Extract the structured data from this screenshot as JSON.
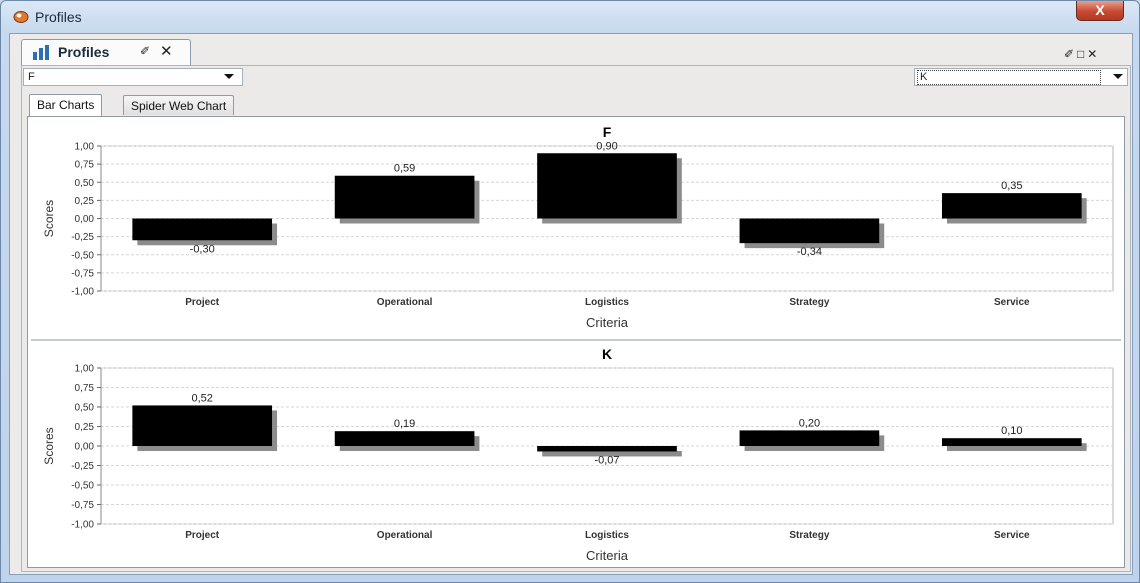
{
  "window": {
    "title": "Profiles",
    "close_glyph": "X"
  },
  "doc_tab": {
    "label": "Profiles",
    "pin_glyph": "✐",
    "close_glyph": "✕"
  },
  "pane_controls": "✐□✕",
  "selectors": {
    "left_value": "F",
    "right_value": "K"
  },
  "tabs": [
    {
      "label": "Bar Charts",
      "selected": true
    },
    {
      "label": "Spider Web Chart",
      "selected": false
    }
  ],
  "colors": {
    "bar": "#000000",
    "bar_shadow": "#8c8c8c",
    "grid": "#d7d7d7"
  },
  "chart_data": [
    {
      "type": "bar",
      "title": "F",
      "xlabel": "Criteria",
      "ylabel": "Scores",
      "ylim": [
        -1,
        1
      ],
      "yticks": [
        "1,00",
        "0,75",
        "0,50",
        "0,25",
        "0,00",
        "-0,25",
        "-0,50",
        "-0,75",
        "-1,00"
      ],
      "categories": [
        "Project",
        "Operational",
        "Logistics",
        "Strategy",
        "Service"
      ],
      "values": [
        -0.3,
        0.59,
        0.9,
        -0.34,
        0.35
      ],
      "labels": [
        "-0,30",
        "0,59",
        "0,90",
        "-0,34",
        "0,35"
      ],
      "grid": true
    },
    {
      "type": "bar",
      "title": "K",
      "xlabel": "Criteria",
      "ylabel": "Scores",
      "ylim": [
        -1,
        1
      ],
      "yticks": [
        "1,00",
        "0,75",
        "0,50",
        "0,25",
        "0,00",
        "-0,25",
        "-0,50",
        "-0,75",
        "-1,00"
      ],
      "categories": [
        "Project",
        "Operational",
        "Logistics",
        "Strategy",
        "Service"
      ],
      "values": [
        0.52,
        0.19,
        -0.07,
        0.2,
        0.1
      ],
      "labels": [
        "0,52",
        "0,19",
        "-0,07",
        "0,20",
        "0,10"
      ],
      "grid": true
    }
  ]
}
